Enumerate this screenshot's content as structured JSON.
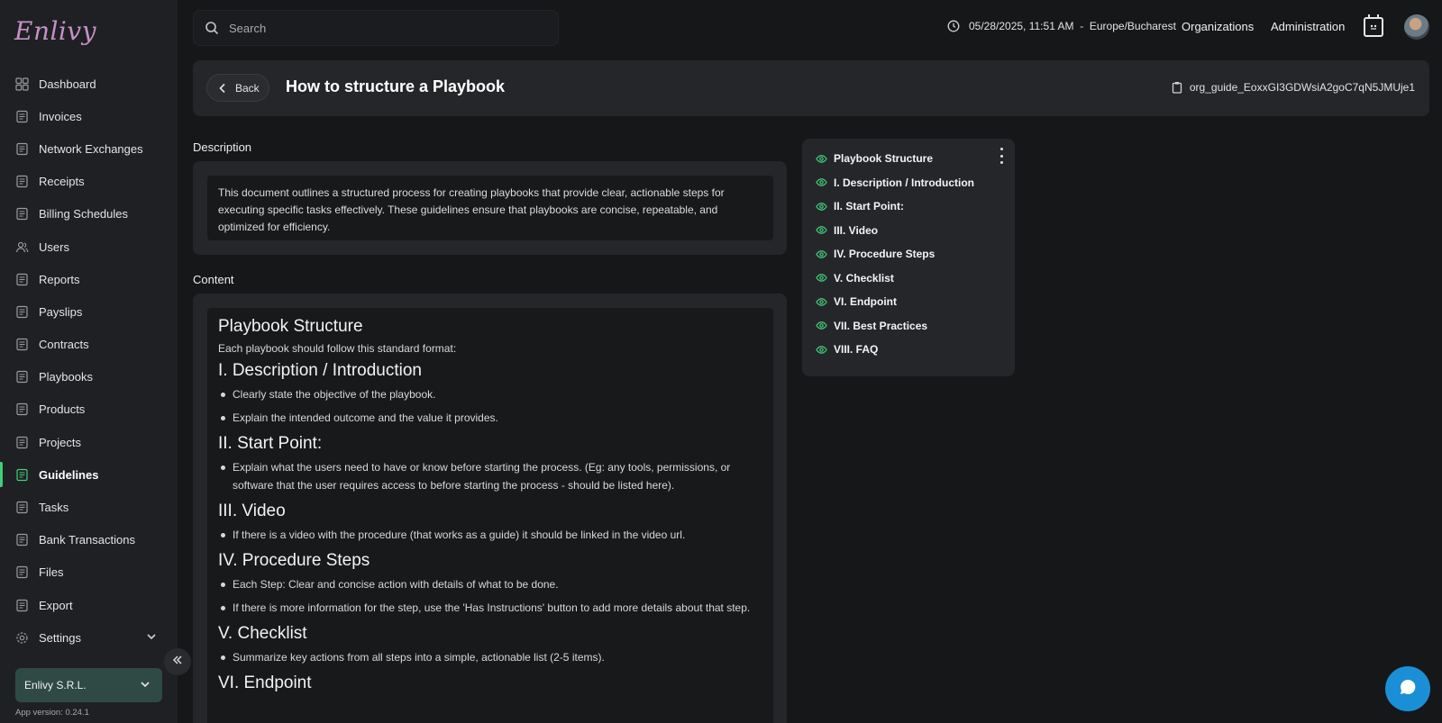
{
  "app": {
    "logo_text": "Enlivy",
    "accent_color": "#3fcf7b"
  },
  "sidebar": {
    "items": [
      {
        "label": "Dashboard",
        "icon": "dashboard-icon",
        "active": false
      },
      {
        "label": "Invoices",
        "icon": "invoice-icon",
        "active": false
      },
      {
        "label": "Network Exchanges",
        "icon": "exchange-icon",
        "active": false
      },
      {
        "label": "Receipts",
        "icon": "receipt-icon",
        "active": false
      },
      {
        "label": "Billing Schedules",
        "icon": "billing-icon",
        "active": false
      },
      {
        "label": "Users",
        "icon": "users-icon",
        "active": false
      },
      {
        "label": "Reports",
        "icon": "reports-icon",
        "active": false
      },
      {
        "label": "Payslips",
        "icon": "payslip-icon",
        "active": false
      },
      {
        "label": "Contracts",
        "icon": "contract-icon",
        "active": false
      },
      {
        "label": "Playbooks",
        "icon": "playbook-icon",
        "active": false
      },
      {
        "label": "Products",
        "icon": "box-icon",
        "active": false
      },
      {
        "label": "Projects",
        "icon": "projects-icon",
        "active": false
      },
      {
        "label": "Guidelines",
        "icon": "guidelines-icon",
        "active": true
      },
      {
        "label": "Tasks",
        "icon": "tasks-icon",
        "active": false
      },
      {
        "label": "Bank Transactions",
        "icon": "bank-icon",
        "active": false
      },
      {
        "label": "Files",
        "icon": "file-icon",
        "active": false
      },
      {
        "label": "Export",
        "icon": "export-icon",
        "active": false
      },
      {
        "label": "Settings",
        "icon": "settings-icon",
        "active": false
      }
    ],
    "organization": "Enlivy S.R.L.",
    "app_version": "App version: 0.24.1"
  },
  "topbar": {
    "search_placeholder": "Search",
    "datetime": "05/28/2025, 11:51 AM  -  Europe/Bucharest",
    "organizations_label": "Organizations",
    "administration_label": "Administration"
  },
  "header": {
    "back_label": "Back",
    "title": "How to structure a Playbook",
    "guide_id": "org_guide_EoxxGI3GDWsiA2goC7qN5JMUje1"
  },
  "description": {
    "label": "Description",
    "text": "This document outlines a structured process for creating playbooks that provide clear, actionable steps for executing specific tasks effectively. These guidelines ensure that playbooks are concise, repeatable, and optimized for efficiency."
  },
  "content": {
    "label": "Content",
    "title": "Playbook Structure",
    "intro": "Each playbook should follow this standard format:",
    "sections": [
      {
        "heading": "I. Description / Introduction",
        "bullets": [
          "Clearly state the objective of the playbook.",
          "Explain the intended outcome and the value it provides."
        ]
      },
      {
        "heading": "II. Start Point:",
        "bullets": [
          "Explain what the users need to have or know before starting the process. (Eg: any tools, permissions, or software that the user requires access to before starting the process - should be listed here)."
        ]
      },
      {
        "heading": "III. Video",
        "bullets": [
          "If there is a video with the procedure (that works as a guide) it should be linked in the video url."
        ]
      },
      {
        "heading": "IV. Procedure Steps",
        "bullets": [
          "Each Step: Clear and concise action with details of what to be done.",
          "If there is more information for the step, use the 'Has Instructions' button to add more details about that step."
        ]
      },
      {
        "heading": "V. Checklist",
        "bullets": [
          "Summarize key actions from all steps into a simple, actionable list (2-5 items)."
        ]
      },
      {
        "heading": "VI. Endpoint",
        "bullets": []
      }
    ]
  },
  "toc": {
    "items": [
      "Playbook Structure",
      "I. Description / Introduction",
      "II. Start Point:",
      "III. Video",
      "IV. Procedure Steps",
      "V. Checklist",
      "VI. Endpoint",
      "VII. Best Practices",
      "VIII. FAQ"
    ]
  }
}
